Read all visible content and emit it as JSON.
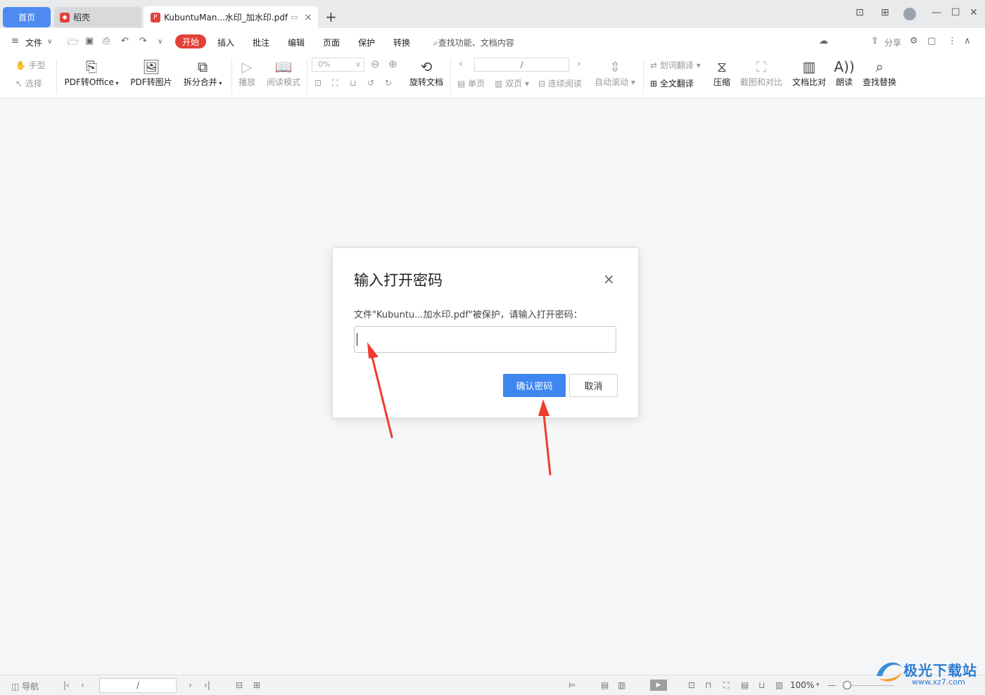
{
  "tabs": {
    "home": "首页",
    "daoke": "稻壳",
    "document": "KubuntuMan...水印_加水印.pdf",
    "close_glyph": "×",
    "add_glyph": "+"
  },
  "menu": {
    "file": "文件",
    "start": "开始",
    "insert": "插入",
    "annotate": "批注",
    "edit": "编辑",
    "page": "页面",
    "protect": "保护",
    "convert": "转换",
    "search_placeholder": "查找功能、文档内容",
    "share": "分享"
  },
  "ribbon": {
    "hand": "手型",
    "select": "选择",
    "pdf_to_office": "PDF转Office",
    "pdf_to_image": "PDF转图片",
    "split_merge": "拆分合并",
    "play": "播放",
    "read_mode": "阅读模式",
    "zoom_value": "0%",
    "rotate_doc": "旋转文档",
    "page_value": "/",
    "single_page": "单页",
    "double_page": "双页",
    "continuous": "连续阅读",
    "auto_scroll": "自动滚动",
    "word_translate": "划词翻译",
    "full_translate": "全文翻译",
    "compress": "压缩",
    "screenshot_compare": "截图和对比",
    "doc_compare": "文档比对",
    "read_aloud": "朗读",
    "find_replace": "查找替换"
  },
  "dialog": {
    "title": "输入打开密码",
    "description": "文件\"Kubuntu...加水印.pdf\"被保护，请输入打开密码：",
    "password_value": "",
    "confirm": "确认密码",
    "cancel": "取消",
    "close_glyph": "×"
  },
  "statusbar": {
    "nav": "导航",
    "page_value": "/",
    "zoom": "100%"
  },
  "watermark": {
    "brand": "极光下载站",
    "url": "www.xz7.com"
  },
  "colors": {
    "accent_blue": "#3f86f1",
    "brand_red": "#e2413a",
    "arrow_red": "#f03a2e"
  }
}
